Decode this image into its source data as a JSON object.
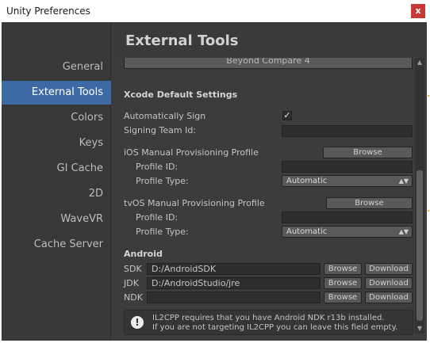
{
  "window": {
    "title": "Unity Preferences",
    "close_label": "x"
  },
  "sidebar": {
    "items": [
      {
        "label": "General"
      },
      {
        "label": "External Tools"
      },
      {
        "label": "Colors"
      },
      {
        "label": "Keys"
      },
      {
        "label": "GI Cache"
      },
      {
        "label": "2D"
      },
      {
        "label": "WaveVR"
      },
      {
        "label": "Cache Server"
      }
    ],
    "active_index": 1
  },
  "header": {
    "title": "External Tools"
  },
  "partial_field": {
    "value": "Beyond Compare 4"
  },
  "xcode": {
    "heading": "Xcode Default Settings",
    "auto_sign_label": "Automatically Sign",
    "auto_sign_checked": "✓",
    "team_id_label": "Signing Team Id:",
    "team_id_value": "",
    "ios": {
      "label": "iOS Manual Provisioning Profile",
      "browse_label": "Browse",
      "profile_id_label": "Profile ID:",
      "profile_id_value": "",
      "profile_type_label": "Profile Type:",
      "profile_type_value": "Automatic"
    },
    "tvos": {
      "label": "tvOS Manual Provisioning Profile",
      "browse_label": "Browse",
      "profile_id_label": "Profile ID:",
      "profile_id_value": "",
      "profile_type_label": "Profile Type:",
      "profile_type_value": "Automatic"
    }
  },
  "android": {
    "heading": "Android",
    "sdk": {
      "label": "SDK",
      "value": "D:/AndroidSDK",
      "browse": "Browse",
      "download": "Download"
    },
    "jdk": {
      "label": "JDK",
      "value": "D:/AndroidStudio/jre",
      "browse": "Browse",
      "download": "Download"
    },
    "ndk": {
      "label": "NDK",
      "value": "",
      "browse": "Browse",
      "download": "Download"
    },
    "info_line1": "IL2CPP requires that you have Android NDK r13b installed.",
    "info_line2": "If you are not targeting IL2CPP you can leave this field empty.",
    "info_icon": "!"
  },
  "icons": {
    "close": "close-icon",
    "check": "checkmark-icon",
    "caret": "dropdown-caret-icon",
    "info": "info-icon",
    "scroll_up": "▲",
    "scroll_down": "▼",
    "caret_glyph": "▲▼"
  },
  "colors": {
    "accent": "#3d6aa5",
    "panel": "#3c3c3c",
    "sidebar": "#383838",
    "close": "#c73a3a"
  }
}
